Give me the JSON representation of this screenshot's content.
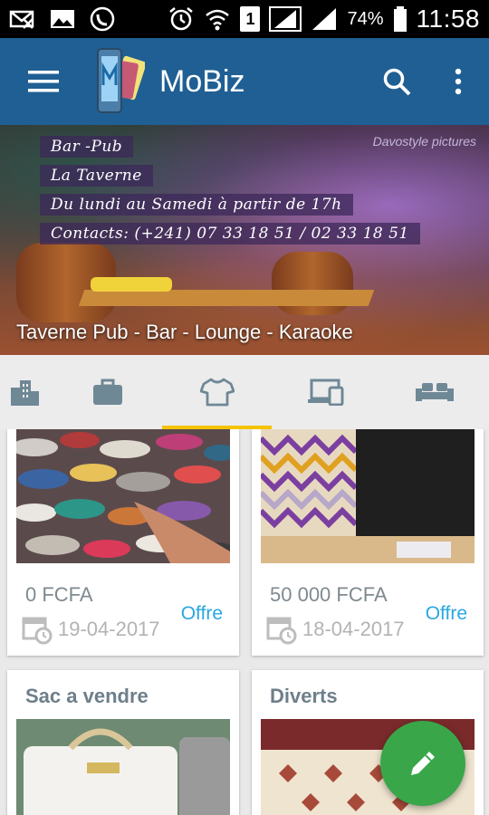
{
  "status_bar": {
    "battery_percent": "74%",
    "time": "11:58",
    "sim_slot": "1"
  },
  "app": {
    "title": "MoBiz"
  },
  "banner": {
    "lines": [
      "Bar -Pub",
      "La Taverne",
      "Du lundi au Samedi à partir de 17h",
      "Contacts: (+241) 07 33 18 51 / 02 33 18 51"
    ],
    "watermark": "Davostyle pictures",
    "caption": "Taverne Pub - Bar - Lounge - Karaoke"
  },
  "tabs": [
    {
      "icon": "buildings-icon",
      "active": false
    },
    {
      "icon": "briefcase-icon",
      "active": false
    },
    {
      "icon": "tshirt-icon",
      "active": true
    },
    {
      "icon": "devices-icon",
      "active": false
    },
    {
      "icon": "sofa-icon",
      "active": false
    }
  ],
  "listings": [
    {
      "price": "0 FCFA",
      "date": "19-04-2017",
      "badge": "Offre"
    },
    {
      "price": "50 000 FCFA",
      "date": "18-04-2017",
      "badge": "Offre"
    },
    {
      "title": "Sac a vendre"
    },
    {
      "title": "Diverts"
    }
  ],
  "colors": {
    "appbar": "#1f5f93",
    "accent_tab": "#f5c300",
    "offer": "#29a7e1",
    "fab": "#3aa64a"
  }
}
